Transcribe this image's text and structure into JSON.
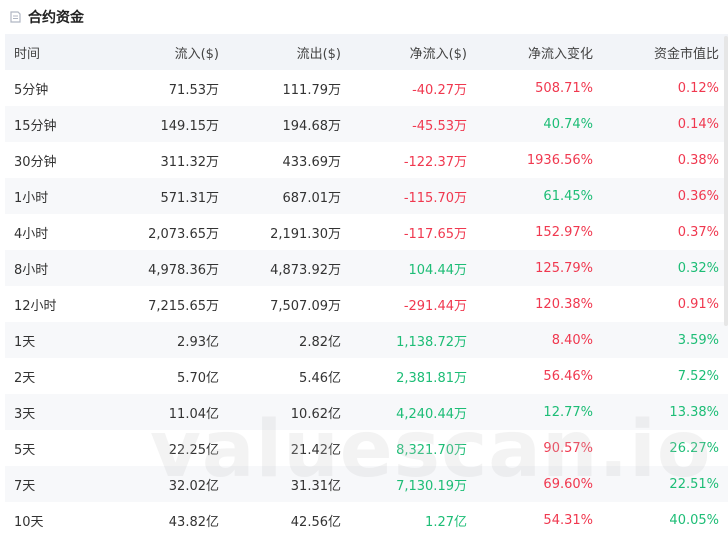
{
  "header": {
    "title": "合约资金"
  },
  "colors": {
    "negative": "#f0384f",
    "positive": "#1dbd76"
  },
  "table": {
    "columns": [
      "时间",
      "流入($)",
      "流出($)",
      "净流入($)",
      "净流入变化",
      "资金市值比"
    ],
    "rows": [
      [
        "5分钟",
        "71.53万",
        "111.79万",
        "-40.27万",
        "508.71%",
        "0.12%"
      ],
      [
        "15分钟",
        "149.15万",
        "194.68万",
        "-45.53万",
        "40.74%",
        "0.14%"
      ],
      [
        "30分钟",
        "311.32万",
        "433.69万",
        "-122.37万",
        "1936.56%",
        "0.38%"
      ],
      [
        "1小时",
        "571.31万",
        "687.01万",
        "-115.70万",
        "61.45%",
        "0.36%"
      ],
      [
        "4小时",
        "2,073.65万",
        "2,191.30万",
        "-117.65万",
        "152.97%",
        "0.37%"
      ],
      [
        "8小时",
        "4,978.36万",
        "4,873.92万",
        "104.44万",
        "125.79%",
        "0.32%"
      ],
      [
        "12小时",
        "7,215.65万",
        "7,507.09万",
        "-291.44万",
        "120.38%",
        "0.91%"
      ],
      [
        "1天",
        "2.93亿",
        "2.82亿",
        "1,138.72万",
        "8.40%",
        "3.59%"
      ],
      [
        "2天",
        "5.70亿",
        "5.46亿",
        "2,381.81万",
        "56.46%",
        "7.52%"
      ],
      [
        "3天",
        "11.04亿",
        "10.62亿",
        "4,240.44万",
        "12.77%",
        "13.38%"
      ],
      [
        "5天",
        "22.25亿",
        "21.42亿",
        "8,321.70万",
        "90.57%",
        "26.27%"
      ],
      [
        "7天",
        "32.02亿",
        "31.31亿",
        "7,130.19万",
        "69.60%",
        "22.51%"
      ],
      [
        "10天",
        "43.82亿",
        "42.56亿",
        "1.27亿",
        "54.31%",
        "40.05%"
      ]
    ],
    "row_sign": [
      "neg",
      "neg",
      "neg",
      "neg",
      "neg",
      "pos",
      "neg",
      "pos",
      "pos",
      "pos",
      "pos",
      "pos",
      "pos"
    ]
  },
  "watermark": "valuescan.io"
}
